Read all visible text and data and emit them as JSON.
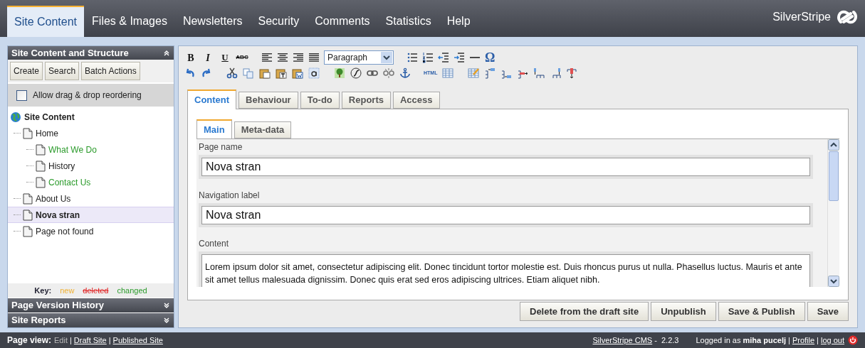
{
  "nav": {
    "tabs": [
      {
        "label": "Site Content",
        "selected": true
      },
      {
        "label": "Files & Images",
        "selected": false
      },
      {
        "label": "Newsletters",
        "selected": false
      },
      {
        "label": "Security",
        "selected": false
      },
      {
        "label": "Comments",
        "selected": false
      },
      {
        "label": "Statistics",
        "selected": false
      },
      {
        "label": "Help",
        "selected": false
      }
    ],
    "brand": "SilverStripe"
  },
  "left": {
    "title": "Site Content and Structure",
    "buttons": [
      "Create",
      "Search",
      "Batch Actions"
    ],
    "drag_reorder": {
      "label": "Allow drag & drop reordering",
      "checked": false
    },
    "tree": {
      "label": "Site Content",
      "children": [
        {
          "label": "Home",
          "changed": false,
          "selected": false,
          "children": [
            {
              "label": "What We Do",
              "changed": true,
              "selected": false
            },
            {
              "label": "History",
              "changed": false,
              "selected": false
            },
            {
              "label": "Contact Us",
              "changed": true,
              "selected": false
            }
          ]
        },
        {
          "label": "About Us",
          "changed": false,
          "selected": false
        },
        {
          "label": "Nova stran",
          "changed": false,
          "selected": true
        },
        {
          "label": "Page not found",
          "changed": false,
          "selected": false
        }
      ]
    },
    "key": {
      "label": "Key:",
      "items": [
        {
          "label": "new",
          "kind": "new"
        },
        {
          "label": "deleted",
          "kind": "deleted"
        },
        {
          "label": "changed",
          "kind": "changed"
        }
      ]
    },
    "collapsed_panels": [
      "Page Version History",
      "Site Reports"
    ]
  },
  "editor": {
    "toolbar": {
      "format_buttons": [
        "B",
        "I",
        "U",
        "ABC"
      ],
      "block_format": "Paragraph",
      "symbol_button": "Ω",
      "html_button": "HTML"
    },
    "tabs": [
      {
        "label": "Content",
        "selected": true
      },
      {
        "label": "Behaviour",
        "selected": false
      },
      {
        "label": "To-do",
        "selected": false
      },
      {
        "label": "Reports",
        "selected": false
      },
      {
        "label": "Access",
        "selected": false
      }
    ],
    "subtabs": [
      {
        "label": "Main",
        "selected": true
      },
      {
        "label": "Meta-data",
        "selected": false
      }
    ],
    "fields": [
      {
        "label": "Page name",
        "value": "Nova stran",
        "kind": "text"
      },
      {
        "label": "Navigation label",
        "value": "Nova stran",
        "kind": "text"
      },
      {
        "label": "Content",
        "value": "Lorem ipsum dolor sit amet, consectetur adipiscing elit. Donec tincidunt tortor molestie est. Duis rhoncus purus ut nulla. Phasellus luctus. Mauris et ante sit amet tellus malesuada dignissim. Donec quis erat sed eros adipiscing ultrices. Etiam aliquet nibh.",
        "kind": "html"
      }
    ],
    "actions": [
      "Delete from the draft site",
      "Unpublish",
      "Save & Publish",
      "Save"
    ]
  },
  "footer": {
    "page_view_label": "Page view:",
    "separator": "|",
    "links": [
      {
        "label": "Edit",
        "kind": "current"
      },
      {
        "label": "Draft Site",
        "kind": "link"
      },
      {
        "label": "Published Site",
        "kind": "link"
      }
    ],
    "cms_link": "SilverStripe CMS",
    "version": "-  2.2.3",
    "logged_in": "Logged in as **miha pucelj**",
    "profile": "Profile",
    "logout": "log out"
  }
}
